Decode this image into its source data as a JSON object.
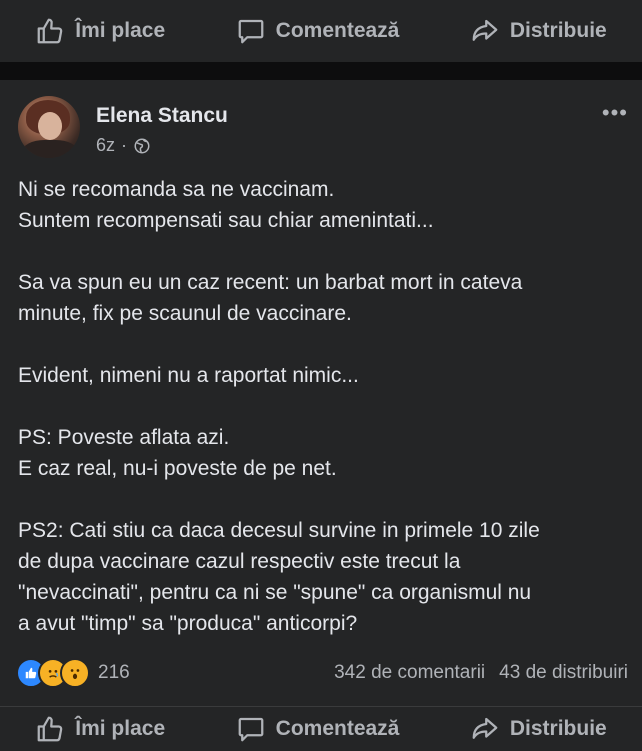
{
  "actions": {
    "like_label": "Îmi place",
    "comment_label": "Comentează",
    "share_label": "Distribuie"
  },
  "post": {
    "author": "Elena Stancu",
    "time": "6z",
    "dot": "·",
    "more": "•••",
    "paragraphs": [
      [
        "Ni se recomanda sa ne vaccinam.",
        "Suntem recompensati sau chiar amenintati..."
      ],
      [
        "Sa va spun eu un caz recent: un barbat mort in cateva",
        "minute, fix pe scaunul de vaccinare."
      ],
      [
        "Evident, nimeni nu a raportat nimic..."
      ],
      [
        "PS: Poveste aflata azi.",
        "E caz real, nu-i poveste de pe net."
      ],
      [
        "PS2: Cati stiu ca daca decesul survine in primele 10 zile",
        "de dupa vaccinare cazul respectiv este trecut la",
        "\"nevaccinati\", pentru ca ni se \"spune\" ca organismul nu",
        "a avut \"timp\" sa \"produca\" anticorpi?"
      ]
    ]
  },
  "stats": {
    "reactions": [
      "like",
      "sad",
      "wow"
    ],
    "reaction_count": "216",
    "comments": "342 de comentarii",
    "shares": "43 de distribuiri"
  },
  "colors": {
    "background": "#18191a",
    "card": "#242526",
    "text": "#e4e6eb",
    "secondary": "#b0b3b8",
    "like_blue": "#2d88ff"
  }
}
